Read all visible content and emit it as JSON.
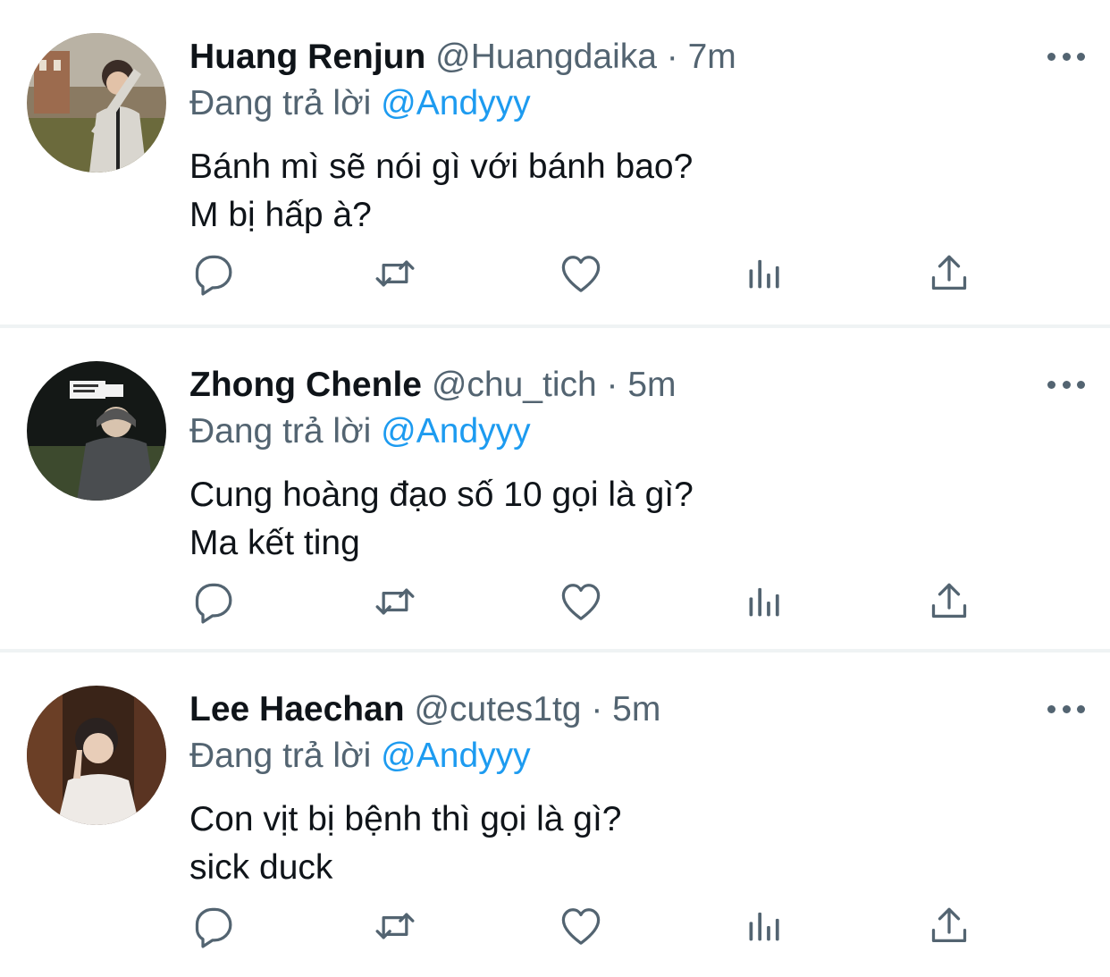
{
  "colors": {
    "secondary_text": "#536471",
    "mention": "#1d9bf0",
    "divider": "#eff3f4"
  },
  "tweets": [
    {
      "name": "Huang Renjun",
      "handle": "@Huangdaika",
      "time": "· 7m",
      "replying_prefix": "Đang trả lời",
      "replying_to": "@Andyyy",
      "lines": [
        "Bánh mì sẽ nói gì với bánh bao?",
        "M bị hấp à?"
      ]
    },
    {
      "name": "Zhong Chenle",
      "handle": "@chu_tich",
      "time": "· 5m",
      "replying_prefix": "Đang trả lời",
      "replying_to": "@Andyyy",
      "lines": [
        "Cung hoàng đạo số 10 gọi là gì?",
        "Ma kết ting"
      ]
    },
    {
      "name": "Lee Haechan",
      "handle": "@cutes1tg",
      "time": "· 5m",
      "replying_prefix": "Đang trả lời",
      "replying_to": "@Andyyy",
      "lines": [
        "Con vịt bị bệnh thì gọi là gì?",
        "sick duck"
      ]
    }
  ],
  "action_icons": [
    "reply-icon",
    "retweet-icon",
    "like-icon",
    "analytics-icon",
    "share-icon"
  ]
}
